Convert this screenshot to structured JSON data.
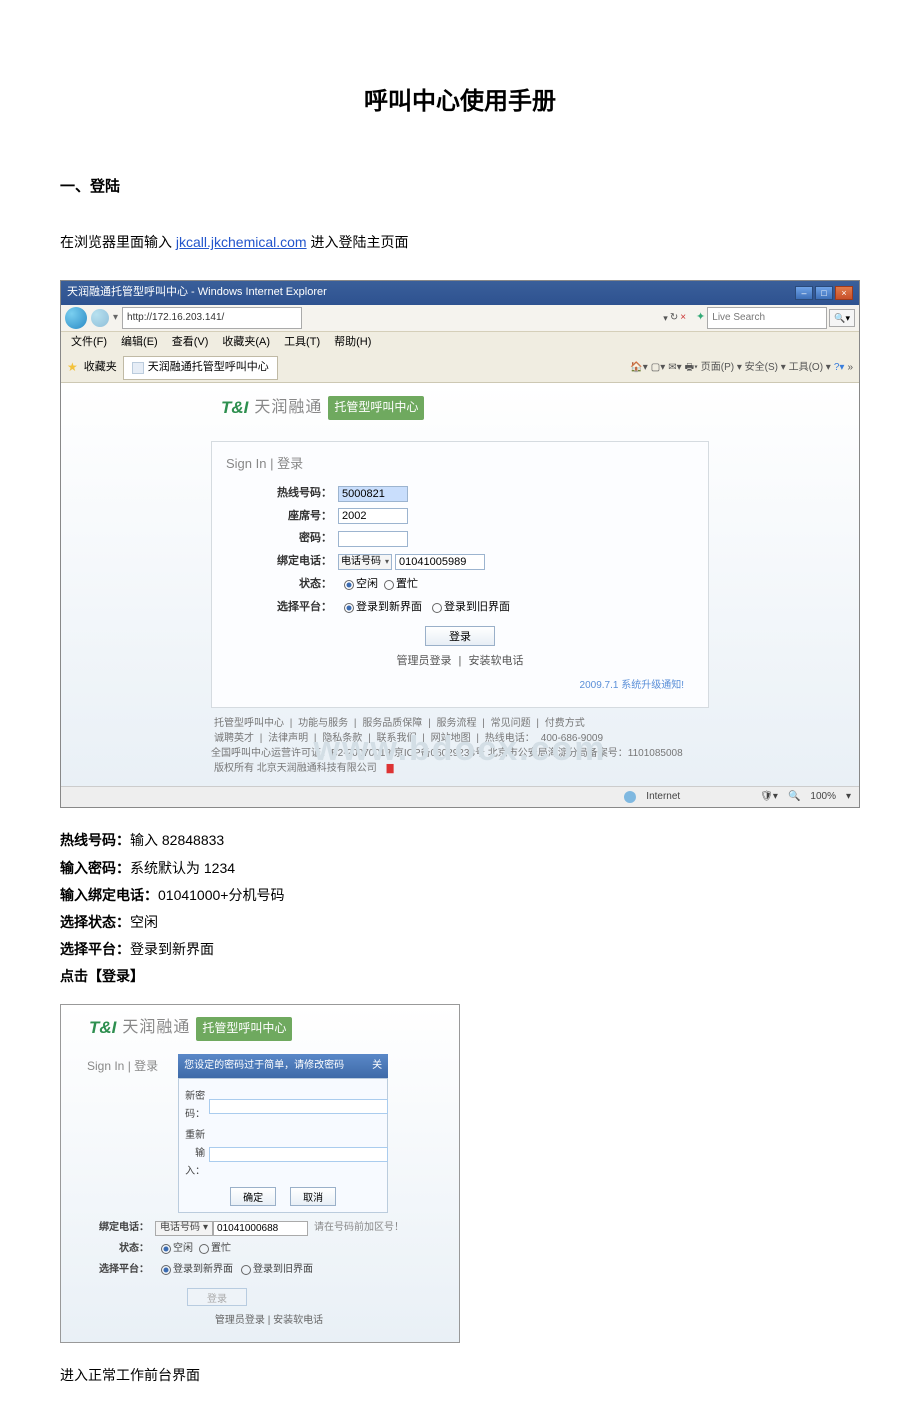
{
  "doc": {
    "title": "呼叫中心使用手册",
    "section1": "一、登陆",
    "instruction_prefix": "在浏览器里面输入 ",
    "instruction_link": "jkcall.jkchemical.com",
    "instruction_suffix": " 进入登陆主页面",
    "final": "进入正常工作前台界面"
  },
  "browser": {
    "title": "天润融通托管型呼叫中心 - Windows Internet Explorer",
    "url": "http://172.16.203.141/",
    "search_placeholder": "Live Search",
    "menu": {
      "file": "文件(F)",
      "edit": "编辑(E)",
      "view": "查看(V)",
      "fav": "收藏夹(A)",
      "tools": "工具(T)",
      "help": "帮助(H)"
    },
    "fav_label": "收藏夹",
    "tab_title": "天润融通托管型呼叫中心",
    "toolbar_right": "页面(P) ▾  安全(S) ▾  工具(O) ▾",
    "status_net": "Internet",
    "status_zoom": "100%"
  },
  "brand": {
    "ti": "T&I",
    "cn": "天润融通",
    "tag": "托管型呼叫中心"
  },
  "signin": {
    "title_en": "Sign In",
    "title_zh": "登录",
    "hotline_label": "热线号码：",
    "hotline_value": "5000821",
    "seat_label": "座席号：",
    "seat_value": "2002",
    "pwd_label": "密码：",
    "bind_label": "绑定电话：",
    "bind_type": "电话号码",
    "bind_value": "01041005989",
    "state_label": "状态：",
    "state_idle": "空闲",
    "state_busy": "置忙",
    "platform_label": "选择平台：",
    "platform_new": "登录到新界面",
    "platform_old": "登录到旧界面",
    "btn": "登录",
    "admin_link": "管理员登录",
    "softphone_link": "安装软电话",
    "notice": "2009.7.1 系统升级通知!"
  },
  "footer": {
    "l1a": "托管型呼叫中心",
    "l1b": "功能与服务",
    "l1c": "服务品质保障",
    "l1d": "服务流程",
    "l1e": "常见问题",
    "l1f": "付费方式",
    "l2a": "诚聘英才",
    "l2b": "法律声明",
    "l2c": "隐私条款",
    "l2d": "联系我们",
    "l2e": "网站地图",
    "l2f_prefix": "热线电话：",
    "l2f_num": "400-686-9009",
    "l3": "全国呼叫中心运营许可证：B2-20070013  京ICP备06029233号 北京市公安局海淀分局备案号：1101085008",
    "l4": "版权所有 北京天润融通科技有限公司"
  },
  "watermark": "www.bdocx.com",
  "info": {
    "l1_b": "热线号码：",
    "l1_t": "输入 82848833",
    "l2_b": "输入密码：",
    "l2_t": "系统默认为 1234",
    "l3_b": "输入绑定电话：",
    "l3_t": "01041000+分机号码",
    "l4_b": "选择状态：",
    "l4_t": "空闲",
    "l5_b": "选择平台：",
    "l5_t": "登录到新界面",
    "l6_b": "点击【登录】"
  },
  "modal": {
    "header": "您设定的密码过于简单，请修改密码",
    "close": "关",
    "new_pwd": "新密码：",
    "repeat": "重新输入：",
    "ok": "确定",
    "cancel": "取消"
  },
  "under": {
    "bind_label": "绑定电话：",
    "bind_type": "电话号码",
    "bind_value": "01041000688",
    "bind_note": "请在号码前加区号！",
    "state_label": "状态：",
    "state_idle": "空闲",
    "state_busy": "置忙",
    "platform_label": "选择平台：",
    "platform_new": "登录到新界面",
    "platform_old": "登录到旧界面",
    "btn": "登录",
    "admin_link": "管理员登录",
    "softphone_link": "安装软电话"
  }
}
